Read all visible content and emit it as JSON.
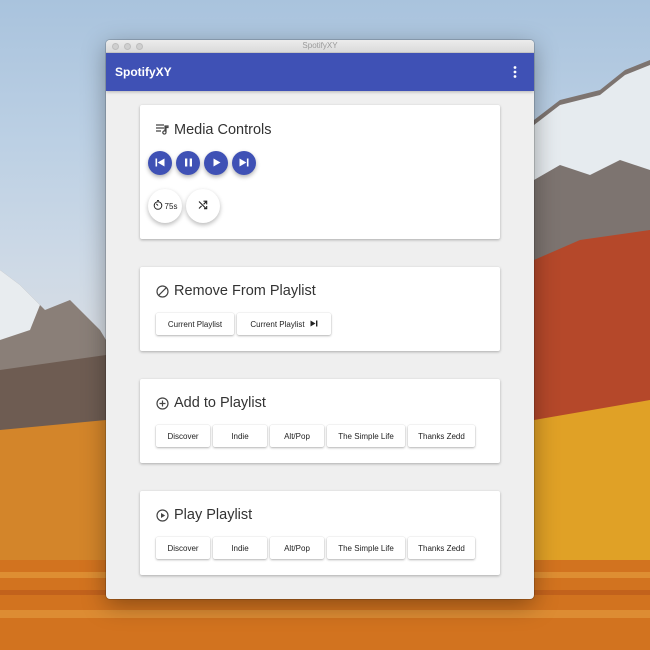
{
  "window": {
    "title": "SpotifyXY"
  },
  "appbar": {
    "title": "SpotifyXY",
    "menu_icon": "more-vert-icon"
  },
  "cards": {
    "media": {
      "title": "Media Controls",
      "icon": "playlist-music-icon",
      "controls": [
        "skip-previous-icon",
        "pause-icon",
        "play-icon",
        "skip-next-icon"
      ],
      "timer_label": "75s",
      "shuffle_icon": "shuffle-icon"
    },
    "remove": {
      "title": "Remove From Playlist",
      "icon": "block-icon",
      "buttons": [
        "Current Playlist",
        "Current Playlist"
      ]
    },
    "add": {
      "title": "Add to Playlist",
      "icon": "add-circle-icon",
      "buttons": [
        "Discover",
        "Indie",
        "Alt/Pop",
        "The Simple Life",
        "Thanks Zedd"
      ]
    },
    "play": {
      "title": "Play Playlist",
      "icon": "play-circle-icon",
      "buttons": [
        "Discover",
        "Indie",
        "Alt/Pop",
        "The Simple Life",
        "Thanks Zedd"
      ]
    }
  },
  "colors": {
    "primary": "#3f51b5",
    "background": "#efefef",
    "card": "#ffffff"
  }
}
